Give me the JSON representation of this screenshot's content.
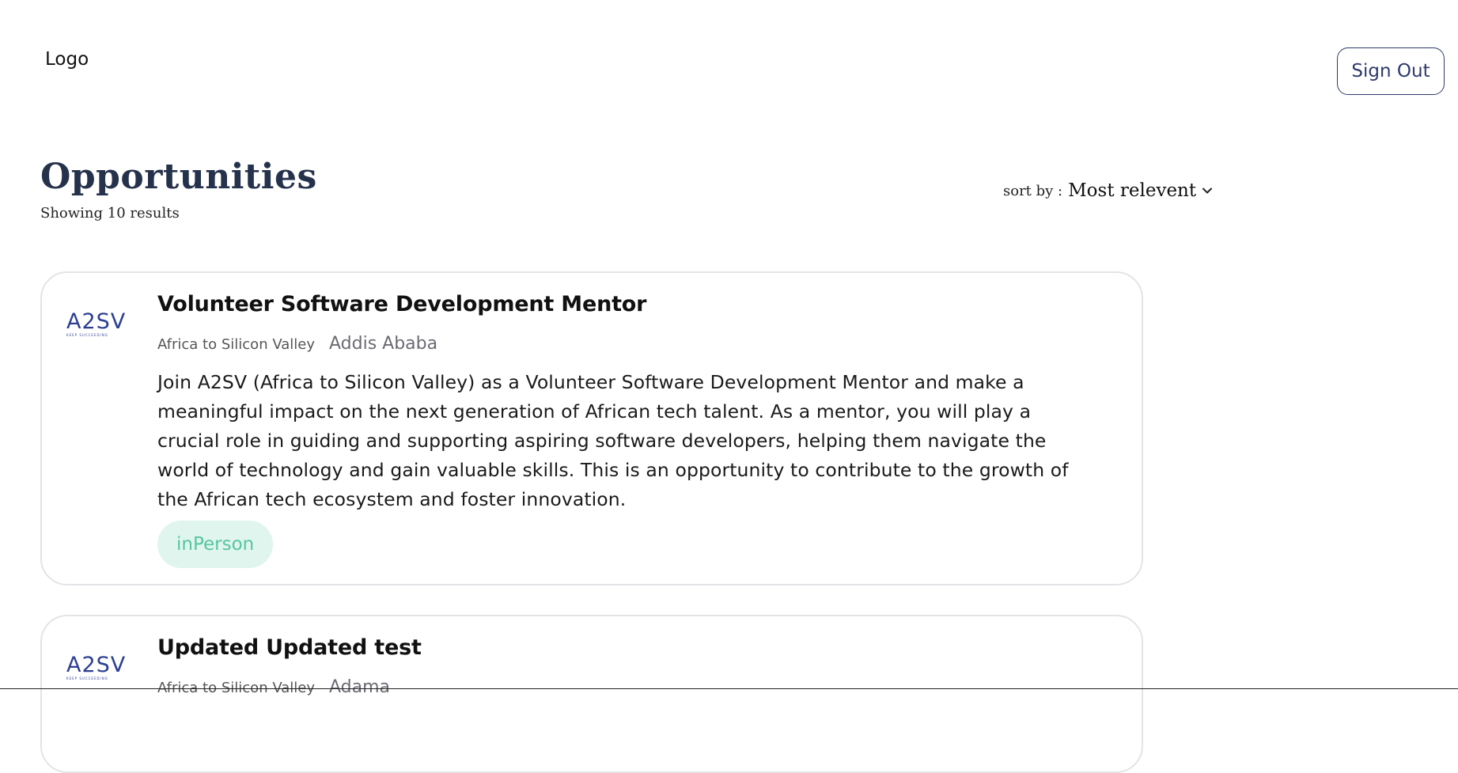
{
  "header": {
    "logo_text": "Logo",
    "sign_out_label": "Sign Out"
  },
  "page": {
    "title": "Opportunities",
    "result_count": "Showing 10 results",
    "sort_label": "sort by :",
    "sort_value": "Most relevent"
  },
  "cards": [
    {
      "org_logo_text": "A2SV",
      "org_logo_tagline": "KEEP SUCCEEDING",
      "title": "Volunteer Software Development Mentor",
      "company": "Africa to Silicon Valley",
      "location": "Addis Ababa",
      "description": "Join A2SV (Africa to Silicon Valley) as a Volunteer Software Development Mentor and make a meaningful impact on the next generation of African tech talent. As a mentor, you will play a crucial role in guiding and supporting aspiring software developers, helping them navigate the world of technology and gain valuable skills. This is an opportunity to contribute to the growth of the African tech ecosystem and foster innovation.",
      "badge": "inPerson"
    },
    {
      "org_logo_text": "A2SV",
      "org_logo_tagline": "KEEP SUCCEEDING",
      "title": "Updated Updated test",
      "company": "Africa to Silicon Valley",
      "location": "Adama"
    }
  ],
  "colors": {
    "title": "#25324b",
    "sign_out_border": "#2f3a6b",
    "badge_bg": "#dff5ee",
    "badge_text": "#56c6a0",
    "card_border": "#e4e4e8"
  },
  "icons": {
    "sort_chevron": "chevron-down-icon"
  }
}
